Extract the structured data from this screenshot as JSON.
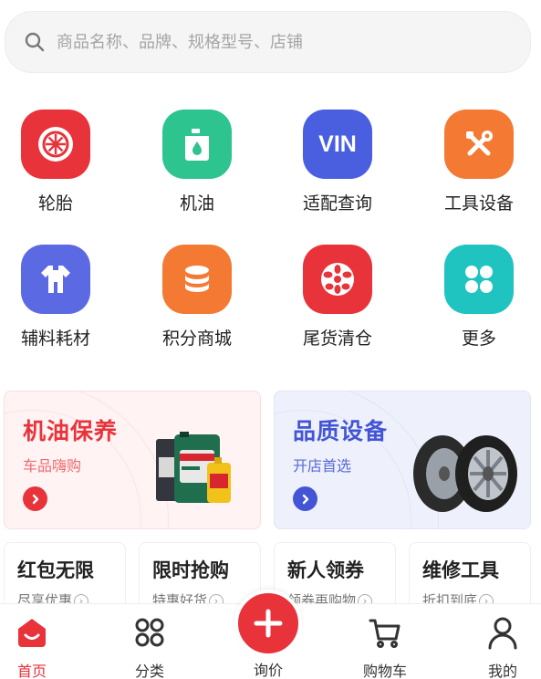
{
  "search": {
    "placeholder": "商品名称、品牌、规格型号、店铺"
  },
  "grid": [
    {
      "label": "轮胎",
      "icon": "tire-icon",
      "color": "#e8333b"
    },
    {
      "label": "机油",
      "icon": "oil-can-icon",
      "color": "#2ec48f"
    },
    {
      "label": "适配查询",
      "icon": "vin-icon",
      "color": "#4a5ee0",
      "icon_text": "VIN"
    },
    {
      "label": "工具设备",
      "icon": "tools-icon",
      "color": "#f47a34"
    },
    {
      "label": "辅料耗材",
      "icon": "coverall-icon",
      "color": "#5b6ae3"
    },
    {
      "label": "积分商城",
      "icon": "coins-icon",
      "color": "#f47a34"
    },
    {
      "label": "尾货清仓",
      "icon": "wheel-icon",
      "color": "#e8333b"
    },
    {
      "label": "更多",
      "icon": "more-icon",
      "color": "#1fc4c1"
    }
  ],
  "promos": [
    {
      "title": "机油保养",
      "subtitle": "车品嗨购",
      "color": "#e8333b"
    },
    {
      "title": "品质设备",
      "subtitle": "开店首选",
      "color": "#4355d6"
    }
  ],
  "deals": [
    {
      "title": "红包无限",
      "subtitle": "尽享优惠"
    },
    {
      "title": "限时抢购",
      "subtitle": "特惠好货"
    },
    {
      "title": "新人领券",
      "subtitle": "领券再购物"
    },
    {
      "title": "维修工具",
      "subtitle": "折扣到底"
    }
  ],
  "tabbar": {
    "home": "首页",
    "category": "分类",
    "inquiry": "询价",
    "cart": "购物车",
    "mine": "我的",
    "active_color": "#e8333b"
  }
}
